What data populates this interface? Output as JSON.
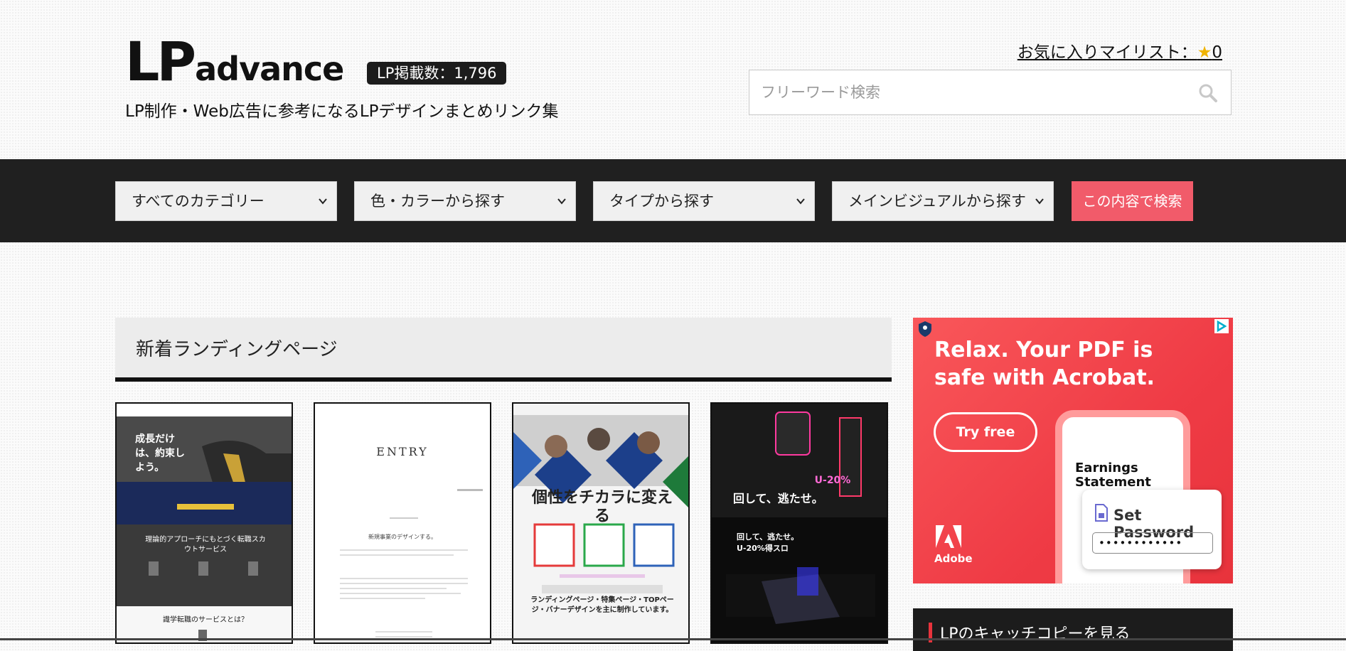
{
  "header": {
    "logo_lp": "LP",
    "logo_advance": "advance",
    "count_badge": "LP掲載数：1,796",
    "tagline": "LP制作・Web広告に参考になるLPデザインまとめリンク集",
    "favorites_label": "お気に入りマイリスト：",
    "favorites_star": "★",
    "favorites_count": "0",
    "search_placeholder": "フリーワード検索"
  },
  "filters": {
    "category": "すべてのカテゴリー",
    "color": "色・カラーから探す",
    "type": "タイプから探す",
    "main_visual": "メインビジュアルから探す",
    "search_button": "この内容で検索"
  },
  "main": {
    "section_title": "新着ランディングページ",
    "thumbs": [
      {
        "headline": "成長だけは、約束しよう。",
        "sub": "理論的アプローチにもとづく転職スカウトサービス",
        "footer": "識学転職のサービスとは？"
      },
      {
        "headline": "ENTRY",
        "sub": "新規事業のデザインする。"
      },
      {
        "headline": "個性をチカラに変える",
        "sub": "ランディングページ・特集ページ・TOPページ・バナーデザインを主に制作しています。"
      },
      {
        "headline": "回して、逃たせ。",
        "badge": "U-20%",
        "sub": "回して、逃たせ。 U-20%得スロ"
      }
    ]
  },
  "ad": {
    "headline": "Relax. Your PDF is safe with Acrobat.",
    "cta": "Try free",
    "phone_title": "Earnings Statement",
    "pw_title": "Set Password",
    "pw_value": "••••••••••••",
    "brand": "Adobe",
    "accent": "#e8333c"
  },
  "sidebar": {
    "catchcopy_title": "LPのキャッチコピーを見る"
  },
  "colors": {
    "navbar": "#202020",
    "search_button": "#f15b6a",
    "star": "#f0b400"
  }
}
